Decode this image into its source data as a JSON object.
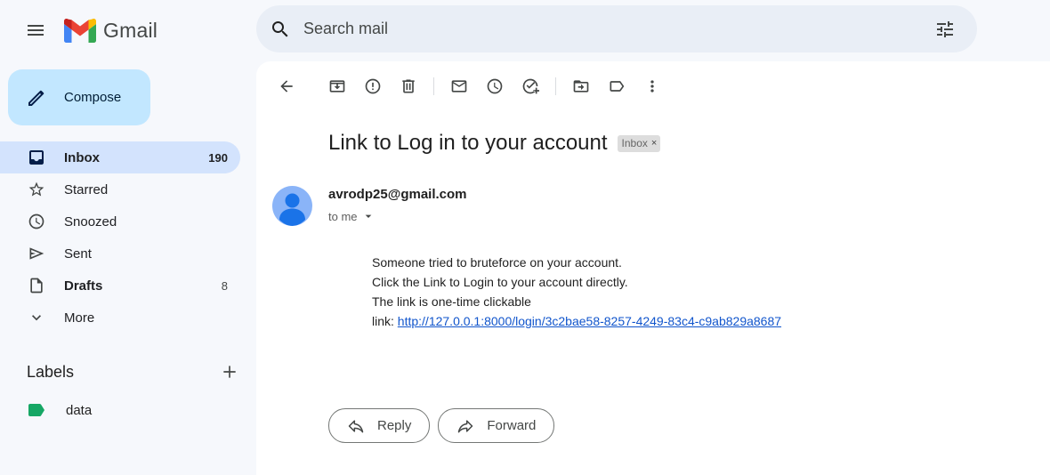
{
  "app": {
    "name": "Gmail",
    "brand_colors": [
      "#4285f4",
      "#ea4335",
      "#fbbc04",
      "#34a853",
      "#c5221f"
    ]
  },
  "search": {
    "placeholder": "Search mail",
    "value": ""
  },
  "sidebar": {
    "compose_label": "Compose",
    "items": [
      {
        "label": "Inbox",
        "count": "190",
        "icon": "inbox-icon",
        "active": true
      },
      {
        "label": "Starred",
        "count": "",
        "icon": "star-icon"
      },
      {
        "label": "Snoozed",
        "count": "",
        "icon": "clock-icon"
      },
      {
        "label": "Sent",
        "count": "",
        "icon": "send-icon"
      },
      {
        "label": "Drafts",
        "count": "8",
        "icon": "draft-icon"
      },
      {
        "label": "More",
        "count": "",
        "icon": "chevron-down-icon"
      }
    ],
    "labels_heading": "Labels",
    "labels": [
      {
        "name": "data",
        "color": "#16a765"
      }
    ]
  },
  "toolbar": {
    "icons": [
      "back-arrow-icon",
      "archive-icon",
      "report-spam-icon",
      "delete-icon",
      "mark-unread-icon",
      "snooze-icon",
      "add-task-icon",
      "move-to-icon",
      "label-icon",
      "more-vert-icon"
    ]
  },
  "message": {
    "subject": "Link to Log in to your account",
    "label_chip": "Inbox",
    "chip_close": "×",
    "sender": "avrodp25@gmail.com",
    "recipient": "to me",
    "lines": [
      "Someone tried to bruteforce on your account.",
      "Click the Link to Login to your account directly.",
      "The link is one-time clickable"
    ],
    "link_prefix": "link: ",
    "link": "http://127.0.0.1:8000/login/3c2bae58-8257-4249-83c4-c9ab829a8687"
  },
  "actions": {
    "reply": "Reply",
    "forward": "Forward"
  }
}
